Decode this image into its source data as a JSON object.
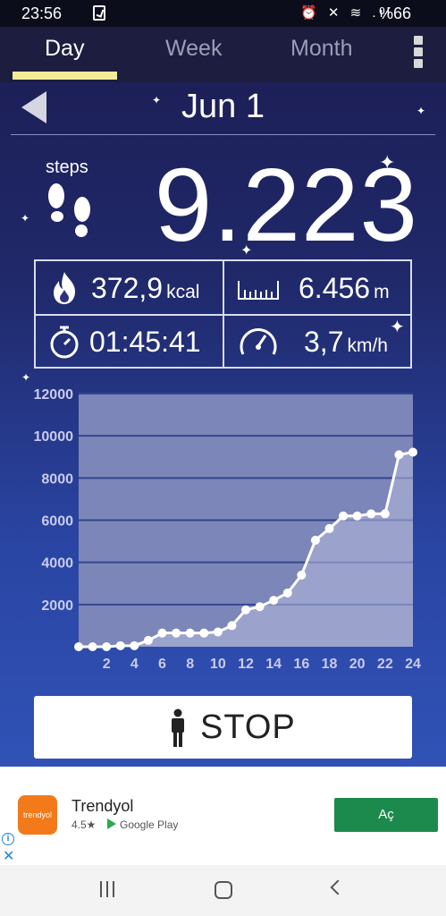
{
  "status_bar": {
    "time": "23:56",
    "icons": "⏰ ✕ ≋ .ıl",
    "battery": "%66"
  },
  "tabs": [
    {
      "label": "Day",
      "active": true
    },
    {
      "label": "Week",
      "active": false
    },
    {
      "label": "Month",
      "active": false
    }
  ],
  "date": "Jun 1",
  "steps": {
    "label": "steps",
    "value": "9.223"
  },
  "stats": {
    "calories": {
      "value": "372,9",
      "unit": "kcal",
      "icon": "flame-icon"
    },
    "distance": {
      "value": "6.456",
      "unit": "m",
      "icon": "ruler-icon"
    },
    "duration": {
      "value": "01:45:41",
      "icon": "stopwatch-icon"
    },
    "speed": {
      "value": "3,7",
      "unit": "km/h",
      "icon": "speedometer-icon"
    }
  },
  "chart_data": {
    "type": "line",
    "x": [
      0,
      1,
      2,
      3,
      4,
      5,
      6,
      7,
      8,
      9,
      10,
      11,
      12,
      13,
      14,
      15,
      16,
      17,
      18,
      19,
      20,
      21,
      22,
      23,
      24
    ],
    "values": [
      0,
      0,
      0,
      50,
      50,
      300,
      650,
      650,
      650,
      650,
      700,
      1000,
      1750,
      1900,
      2200,
      2550,
      3400,
      5050,
      5600,
      6200,
      6200,
      6300,
      6300,
      9100,
      9223
    ],
    "xticks": [
      "2",
      "4",
      "6",
      "8",
      "10",
      "12",
      "14",
      "16",
      "18",
      "20",
      "22",
      "24"
    ],
    "yticks": [
      "2000",
      "4000",
      "6000",
      "8000",
      "10000",
      "12000"
    ],
    "xlim": [
      0,
      24
    ],
    "ylim": [
      0,
      12000
    ],
    "grid": true,
    "colors": {
      "plot_bg": "#7c86b8",
      "line": "#ffffff",
      "fill": "#b4bbdc",
      "grid": "#34458f",
      "tick_label": "#c9cbee"
    }
  },
  "stop_button": {
    "label": "STOP",
    "icon": "person-icon"
  },
  "ad": {
    "logo_text": "trendyol",
    "title": "Trendyol",
    "rating": "4.5★",
    "store": "Google Play",
    "cta": "Aç",
    "info": "i",
    "close": "✕"
  },
  "colors": {
    "accent": "#f3ec98",
    "cta": "#1d8a4d",
    "brand": "#f27a1a"
  }
}
